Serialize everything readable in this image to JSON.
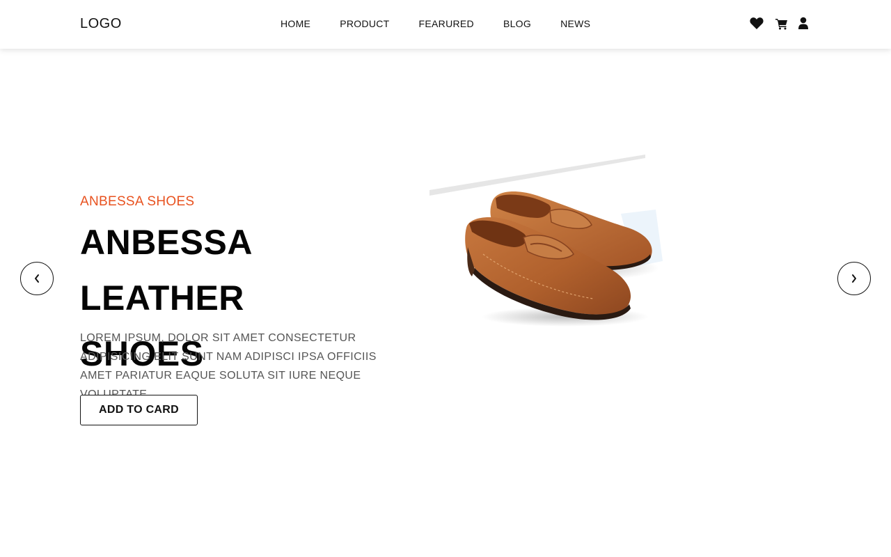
{
  "header": {
    "logo": "LOGO",
    "nav": [
      {
        "label": "HOME"
      },
      {
        "label": "PRODUCT"
      },
      {
        "label": "FEARURED"
      },
      {
        "label": "BLOG"
      },
      {
        "label": "NEWS"
      }
    ],
    "icons": [
      "heart-icon",
      "cart-icon",
      "user-icon"
    ]
  },
  "hero": {
    "eyebrow": "ANBESSA SHOES",
    "title_line1": "ANBESSA LEATHER",
    "title_line2": "SHOES",
    "description": "LOREM IPSUM, DOLOR SIT AMET CONSECTETUR ADIPISICING ELIT SUNT NAM ADIPISCI IPSA OFFICIIS AMET PARIATUR EAQUE SOLUTA SIT IURE NEQUE VOLUPTATE.",
    "cta_label": "ADD TO CARD",
    "prev_icon": "chevron-left-icon",
    "next_icon": "chevron-right-icon"
  },
  "colors": {
    "accent": "#e8521f",
    "text": "#050505",
    "muted": "#555555",
    "shoe": "#b4652f"
  }
}
